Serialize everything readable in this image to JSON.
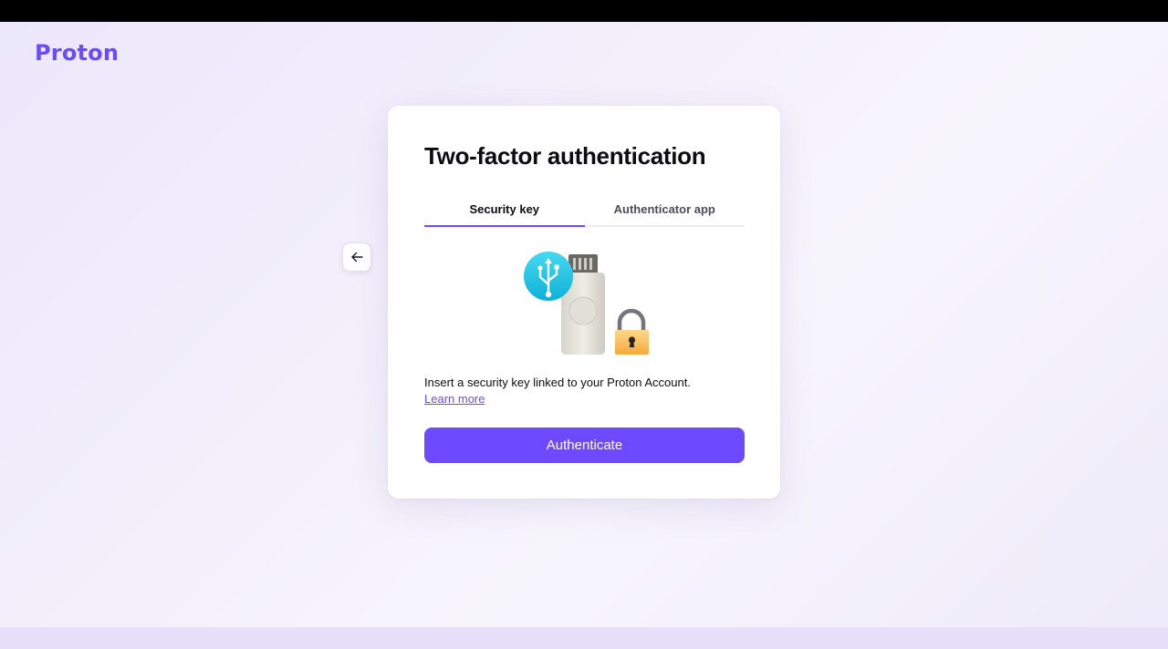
{
  "brand": {
    "logo_text": "Proton",
    "accent_color": "#6d4aff"
  },
  "navigation": {
    "back_icon": "arrow-left-icon"
  },
  "card": {
    "title": "Two-factor authentication",
    "tabs": [
      {
        "label": "Security key",
        "active": true
      },
      {
        "label": "Authenticator app",
        "active": false
      }
    ],
    "illustration_icons": [
      "usb-icon",
      "security-key-icon",
      "padlock-icon"
    ],
    "description": "Insert a security key linked to your Proton Account.",
    "learn_more_label": "Learn more",
    "authenticate_label": "Authenticate"
  }
}
